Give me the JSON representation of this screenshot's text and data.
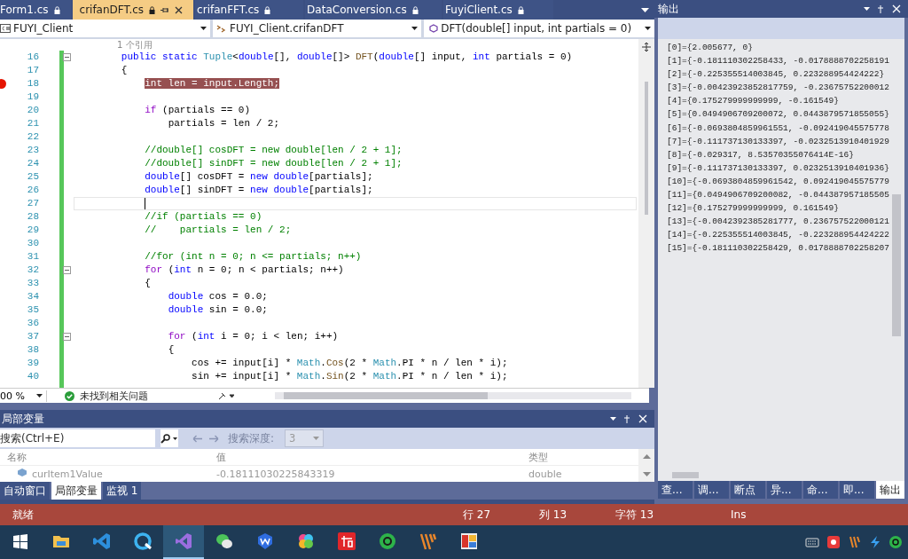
{
  "tabs": [
    {
      "label": "Form1.cs",
      "selected": false
    },
    {
      "label": "crifanDFT.cs",
      "selected": true
    },
    {
      "label": "crifanFFT.cs",
      "selected": false
    },
    {
      "label": "DataConversion.cs",
      "selected": false
    },
    {
      "label": "FuyiClient.cs",
      "selected": false
    }
  ],
  "nav": {
    "project": "FUYI_Client",
    "class": "FUYI_Client.crifanDFT",
    "member": "DFT(double[] input, int partials = 0)"
  },
  "code": {
    "reference_note": "1 个引用",
    "lines": [
      {
        "number": "16",
        "fold": true,
        "breakpoint": false,
        "current": false,
        "tokens": [
          {
            "text": "        public static",
            "kind": "keyword"
          },
          {
            "text": " Tuple",
            "kind": "type"
          },
          {
            "text": "<",
            "kind": "plain"
          },
          {
            "text": "double",
            "kind": "keyword"
          },
          {
            "text": "[], ",
            "kind": "plain"
          },
          {
            "text": "double",
            "kind": "keyword"
          },
          {
            "text": "[]> ",
            "kind": "plain"
          },
          {
            "text": "DFT",
            "kind": "method"
          },
          {
            "text": "(",
            "kind": "plain"
          },
          {
            "text": "double",
            "kind": "keyword"
          },
          {
            "text": "[] input, ",
            "kind": "plain"
          },
          {
            "text": "int",
            "kind": "keyword"
          },
          {
            "text": " partials = 0)",
            "kind": "plain"
          }
        ]
      },
      {
        "number": "17",
        "fold": false,
        "breakpoint": false,
        "current": false,
        "tokens": [
          {
            "text": "        {",
            "kind": "plain"
          }
        ]
      },
      {
        "number": "18",
        "fold": false,
        "breakpoint": true,
        "current": false,
        "tokens": [
          {
            "text": "            int len = input.Length;",
            "kind": "breakpoint"
          }
        ]
      },
      {
        "number": "19",
        "fold": false,
        "breakpoint": false,
        "current": false
      },
      {
        "number": "20",
        "fold": false,
        "breakpoint": false,
        "current": false,
        "tokens": [
          {
            "text": "            if",
            "kind": "control"
          },
          {
            "text": " (partials == 0)",
            "kind": "plain"
          }
        ]
      },
      {
        "number": "21",
        "fold": false,
        "breakpoint": false,
        "current": false,
        "tokens": [
          {
            "text": "                partials = len / 2;",
            "kind": "plain"
          }
        ]
      },
      {
        "number": "22",
        "fold": false,
        "breakpoint": false,
        "current": false
      },
      {
        "number": "23",
        "fold": false,
        "breakpoint": false,
        "current": false,
        "tokens": [
          {
            "text": "            //double[] cosDFT = new double[len / 2 + 1];",
            "kind": "comment"
          }
        ]
      },
      {
        "number": "24",
        "fold": false,
        "breakpoint": false,
        "current": false,
        "tokens": [
          {
            "text": "            //double[] sinDFT = new double[len / 2 + 1];",
            "kind": "comment"
          }
        ]
      },
      {
        "number": "25",
        "fold": false,
        "breakpoint": false,
        "current": false,
        "tokens": [
          {
            "text": "            double",
            "kind": "keyword"
          },
          {
            "text": "[] cosDFT = ",
            "kind": "plain"
          },
          {
            "text": "new double",
            "kind": "keyword"
          },
          {
            "text": "[partials];",
            "kind": "plain"
          }
        ]
      },
      {
        "number": "26",
        "fold": false,
        "breakpoint": false,
        "current": false,
        "tokens": [
          {
            "text": "            double",
            "kind": "keyword"
          },
          {
            "text": "[] sinDFT = ",
            "kind": "plain"
          },
          {
            "text": "new double",
            "kind": "keyword"
          },
          {
            "text": "[partials];",
            "kind": "plain"
          }
        ]
      },
      {
        "number": "27",
        "fold": false,
        "breakpoint": false,
        "current": true
      },
      {
        "number": "28",
        "fold": false,
        "breakpoint": false,
        "current": false,
        "tokens": [
          {
            "text": "            //if (partials == 0)",
            "kind": "comment"
          }
        ]
      },
      {
        "number": "29",
        "fold": false,
        "breakpoint": false,
        "current": false,
        "tokens": [
          {
            "text": "            //    partials = len / 2;",
            "kind": "comment"
          }
        ]
      },
      {
        "number": "30",
        "fold": false,
        "breakpoint": false,
        "current": false
      },
      {
        "number": "31",
        "fold": false,
        "breakpoint": false,
        "current": false,
        "tokens": [
          {
            "text": "            //for (int n = 0; n <= partials; n++)",
            "kind": "comment"
          }
        ]
      },
      {
        "number": "32",
        "fold": true,
        "breakpoint": false,
        "current": false,
        "tokens": [
          {
            "text": "            for",
            "kind": "control"
          },
          {
            "text": " (",
            "kind": "plain"
          },
          {
            "text": "int",
            "kind": "keyword"
          },
          {
            "text": " n = 0; n < partials; n++)",
            "kind": "plain"
          }
        ]
      },
      {
        "number": "33",
        "fold": false,
        "breakpoint": false,
        "current": false,
        "tokens": [
          {
            "text": "            {",
            "kind": "plain"
          }
        ]
      },
      {
        "number": "34",
        "fold": false,
        "breakpoint": false,
        "current": false,
        "tokens": [
          {
            "text": "                double",
            "kind": "keyword"
          },
          {
            "text": " cos = 0.0;",
            "kind": "plain"
          }
        ]
      },
      {
        "number": "35",
        "fold": false,
        "breakpoint": false,
        "current": false,
        "tokens": [
          {
            "text": "                double",
            "kind": "keyword"
          },
          {
            "text": " sin = 0.0;",
            "kind": "plain"
          }
        ]
      },
      {
        "number": "36",
        "fold": false,
        "breakpoint": false,
        "current": false
      },
      {
        "number": "37",
        "fold": true,
        "breakpoint": false,
        "current": false,
        "tokens": [
          {
            "text": "                for",
            "kind": "control"
          },
          {
            "text": " (",
            "kind": "plain"
          },
          {
            "text": "int",
            "kind": "keyword"
          },
          {
            "text": " i = 0; i < len; i++)",
            "kind": "plain"
          }
        ]
      },
      {
        "number": "38",
        "fold": false,
        "breakpoint": false,
        "current": false,
        "tokens": [
          {
            "text": "                {",
            "kind": "plain"
          }
        ]
      },
      {
        "number": "39",
        "fold": false,
        "breakpoint": false,
        "current": false,
        "tokens": [
          {
            "text": "                    cos += input[i] * ",
            "kind": "plain"
          },
          {
            "text": "Math",
            "kind": "type"
          },
          {
            "text": ".",
            "kind": "plain"
          },
          {
            "text": "Cos",
            "kind": "method"
          },
          {
            "text": "(2 * ",
            "kind": "plain"
          },
          {
            "text": "Math",
            "kind": "type"
          },
          {
            "text": ".PI * n / len * i);",
            "kind": "plain"
          }
        ]
      },
      {
        "number": "40",
        "fold": false,
        "breakpoint": false,
        "current": false,
        "tokens": [
          {
            "text": "                    sin += input[i] * ",
            "kind": "plain"
          },
          {
            "text": "Math",
            "kind": "type"
          },
          {
            "text": ".",
            "kind": "plain"
          },
          {
            "text": "Sin",
            "kind": "method"
          },
          {
            "text": "(2 * ",
            "kind": "plain"
          },
          {
            "text": "Math",
            "kind": "type"
          },
          {
            "text": ".PI * n / len * i);",
            "kind": "plain"
          }
        ]
      }
    ]
  },
  "editor_status": {
    "zoom": "00 %",
    "issues": "未找到相关问题"
  },
  "locals": {
    "title": "局部变量",
    "search_placeholder": "搜索(Ctrl+E)",
    "depth_label": "搜索深度:",
    "depth_value": "3",
    "columns": [
      "名称",
      "值",
      "类型"
    ],
    "rows": [
      {
        "name": "curItem1Value",
        "value": "-0.18111030225843319",
        "type": "double"
      }
    ],
    "tabs": [
      {
        "label": "自动窗口",
        "selected": false
      },
      {
        "label": "局部变量",
        "selected": true
      },
      {
        "label": "监视 1",
        "selected": false
      }
    ]
  },
  "output": {
    "title": "输出",
    "lines": [
      "[0]={2.005677, 0}",
      "[1]={-0.181110302258433, -0.0178888702258191",
      "[2]={-0.225355514003845, 0.223288954424222}",
      "[3]={-0.00423923852817759, -0.23675752200012",
      "[4]={0.175279999999999, -0.161549}",
      "[5]={0.0494906709200072, 0.0443879571855055}",
      "[6]={-0.0693804859961551, -0.092419045575778",
      "[7]={-0.111737130133397, -0.0232513910401929",
      "[8]={-0.029317, 8.53570355076414E-16}",
      "[9]={-0.111737130133397, 0.0232513910401936}",
      "[10]={-0.0693804859961542, 0.092419045575779",
      "[11]={0.0494906709200082, -0.044387957185505",
      "[12]={0.175279999999999, 0.161549}",
      "[13]={-0.0042392385281777, 0.236757522000121",
      "[14]={-0.225355514003845, -0.223288954424222",
      "[15]={-0.181110302258429, 0.0178888702258207"
    ],
    "tabs": [
      {
        "label": "查...",
        "selected": false
      },
      {
        "label": "调...",
        "selected": false
      },
      {
        "label": "断点",
        "selected": false
      },
      {
        "label": "异...",
        "selected": false
      },
      {
        "label": "命...",
        "selected": false
      },
      {
        "label": "即...",
        "selected": false
      },
      {
        "label": "输出",
        "selected": true
      }
    ]
  },
  "status_bar": {
    "state": "就绪",
    "line": "行 27",
    "column": "列 13",
    "char": "字符 13",
    "mode": "Ins"
  },
  "taskbar": [
    {
      "kind": "start",
      "selected": false
    },
    {
      "kind": "folder",
      "selected": false
    },
    {
      "kind": "vscode",
      "selected": false
    },
    {
      "kind": "browser",
      "selected": false
    },
    {
      "kind": "visualstudio",
      "selected": true
    },
    {
      "kind": "chat",
      "selected": false
    },
    {
      "kind": "office",
      "selected": false
    },
    {
      "kind": "petals",
      "selected": false
    },
    {
      "kind": "dictionary",
      "selected": false
    },
    {
      "kind": "notes",
      "selected": false
    },
    {
      "kind": "stripes",
      "selected": false
    },
    {
      "kind": "tiles",
      "selected": false
    }
  ]
}
